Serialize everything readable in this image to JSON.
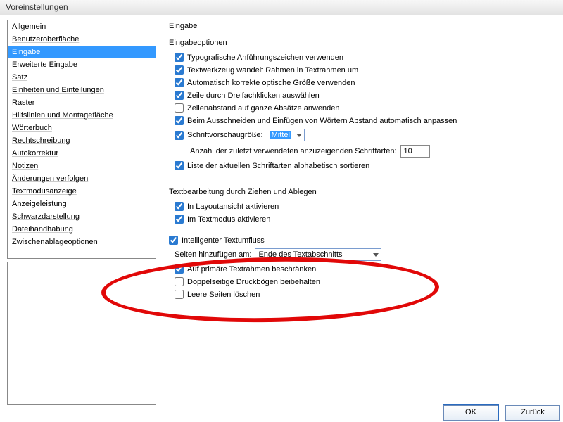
{
  "window": {
    "title": "Voreinstellungen"
  },
  "sidebar": {
    "items": [
      "Allgemein",
      "Benutzeroberfläche",
      "Eingabe",
      "Erweiterte Eingabe",
      "Satz",
      "Einheiten und Einteilungen",
      "Raster",
      "Hilfslinien und Montagefläche",
      "Wörterbuch",
      "Rechtschreibung",
      "Autokorrektur",
      "Notizen",
      "Änderungen verfolgen",
      "Textmodusanzeige",
      "Anzeigeleistung",
      "Schwarzdarstellung",
      "Dateihandhabung",
      "Zwischenablageoptionen"
    ],
    "selected_index": 2
  },
  "main": {
    "heading": "Eingabe",
    "section1_label": "Eingabeoptionen",
    "opt_typo": "Typografische Anführungszeichen verwenden",
    "opt_textwerkzeug": "Textwerkzeug wandelt Rahmen in Textrahmen um",
    "opt_auto_opt": "Automatisch korrekte optische Größe verwenden",
    "opt_triple": "Zeile durch Dreifachklicken auswählen",
    "opt_zeilen": "Zeilenabstand auf ganze Absätze anwenden",
    "opt_cutpaste": "Beim Ausschneiden und Einfügen von Wörtern Abstand automatisch anpassen",
    "opt_preview_label": "Schriftvorschaugröße:",
    "opt_preview_value": "Mittel",
    "opt_recent_label": "Anzahl der zuletzt verwendeten anzuzeigenden Schriftarten:",
    "opt_recent_value": "10",
    "opt_sortfonts": "Liste der aktuellen Schriftarten alphabetisch sortieren",
    "section2_label": "Textbearbeitung durch Ziehen und Ablegen",
    "opt_layout": "In Layoutansicht aktivieren",
    "opt_textmode": "Im Textmodus aktivieren",
    "opt_smart_reflow": "Intelligenter Textumfluss",
    "opt_pages_label": "Seiten hinzufügen am:",
    "opt_pages_value": "Ende des Textabschnitts",
    "opt_primary": "Auf primäre Textrahmen beschränken",
    "opt_facing": "Doppelseitige Druckbögen beibehalten",
    "opt_delete_empty": "Leere Seiten löschen"
  },
  "footer": {
    "ok": "OK",
    "back": "Zurück"
  }
}
